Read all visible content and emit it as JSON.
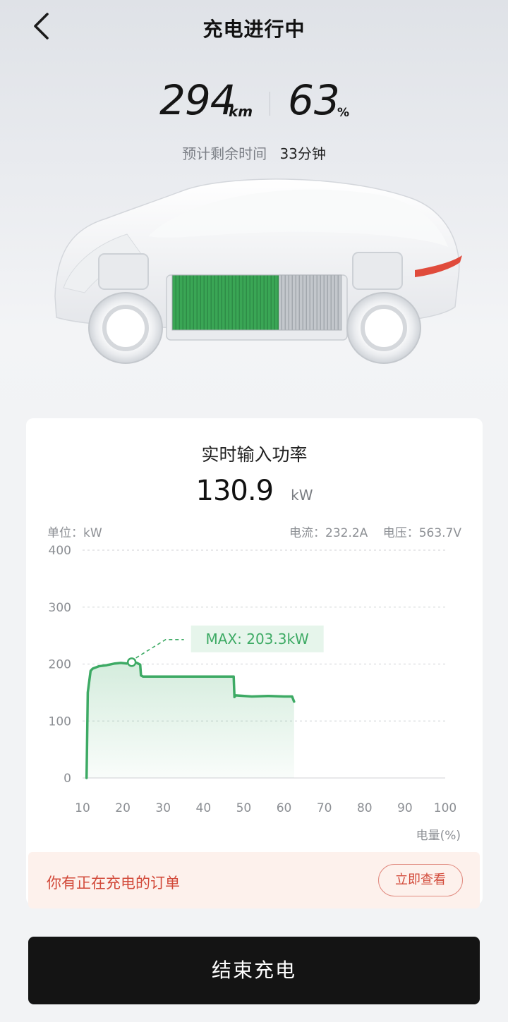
{
  "header": {
    "title": "充电进行中",
    "back_icon": "chevron-left-icon"
  },
  "status": {
    "range_value": "294",
    "range_unit": "km",
    "soc_value": "63",
    "soc_unit": "%",
    "remaining_label": "预计剩余时间",
    "remaining_value": "33分钟"
  },
  "battery": {
    "fill_fraction": 0.63,
    "charged_color": "#3aa655",
    "empty_color": "#b9bdc2"
  },
  "power_card": {
    "title": "实时输入功率",
    "value": "130.9",
    "unit": "kW",
    "unit_label": "单位：kW",
    "current": "电流：232.2A",
    "voltage": "电压：563.7V",
    "max_label": "MAX: 203.3kW",
    "x_axis_label": "电量(%)"
  },
  "chart_data": {
    "type": "area",
    "x_ticks": [
      "10",
      "20",
      "30",
      "40",
      "50",
      "60",
      "70",
      "80",
      "90",
      "100"
    ],
    "y_ticks": [
      "0",
      "100",
      "200",
      "300",
      "400"
    ],
    "xlim": [
      10,
      100
    ],
    "ylim": [
      0,
      400
    ],
    "xlabel": "电量(%)",
    "ylabel": "",
    "grid": true,
    "line_color": "#3daa64",
    "x": [
      11,
      11.3,
      12,
      12.5,
      14,
      16,
      18,
      19.5,
      21,
      22.2,
      23.5,
      24.3,
      24.5,
      25,
      30,
      35,
      40,
      45,
      47.5,
      47.7,
      48,
      52,
      56,
      60,
      62,
      62.5
    ],
    "y": [
      0,
      150,
      188,
      192,
      196,
      198,
      201,
      202,
      201,
      203.3,
      202,
      199,
      180,
      178,
      178,
      178,
      178,
      178,
      178,
      142,
      145,
      143,
      144,
      143,
      143,
      134
    ],
    "annotations": [
      {
        "x": 22.2,
        "y": 203.3,
        "text": "MAX: 203.3kW"
      }
    ]
  },
  "order_banner": {
    "text": "你有正在充电的订单",
    "button": "立即查看"
  },
  "stop_button": {
    "label": "结束充电"
  }
}
